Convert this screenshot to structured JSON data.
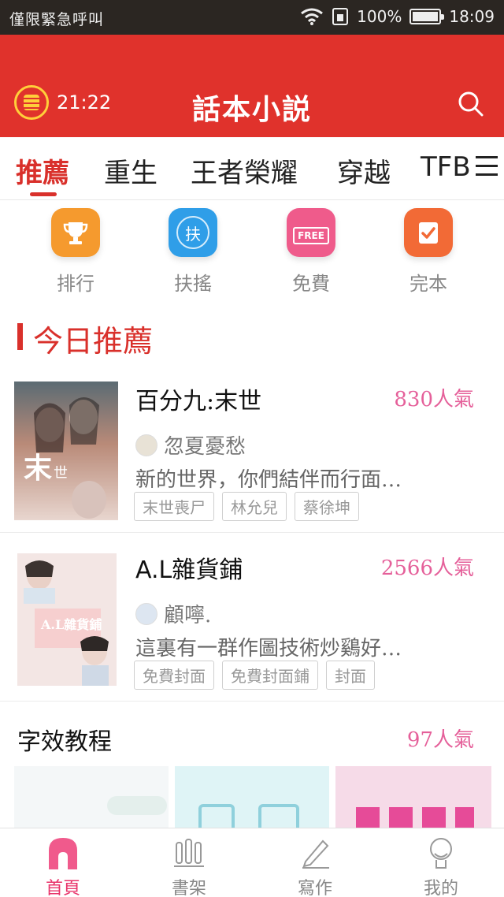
{
  "status_bar": {
    "carrier": "僅限緊急呼叫",
    "battery": "100%",
    "time": "18:09",
    "battery_level": 1.0
  },
  "header": {
    "timer": "21:22",
    "title": "話本小説"
  },
  "tabs": [
    {
      "label": "推薦",
      "active": true
    },
    {
      "label": "重生"
    },
    {
      "label": "王者榮耀"
    },
    {
      "label": "穿越"
    },
    {
      "label": "TFB"
    }
  ],
  "quick_nav": [
    {
      "label": "排行",
      "icon": "trophy-icon",
      "color": "#f59a2e"
    },
    {
      "label": "扶搖",
      "icon": "fuyao-icon",
      "glyph": "扶",
      "color": "#2f9ee8"
    },
    {
      "label": "免費",
      "icon": "free-icon",
      "glyph": "FREE",
      "color": "#ef5b8b"
    },
    {
      "label": "完本",
      "icon": "complete-icon",
      "color": "#f26a36"
    }
  ],
  "section": {
    "title": "今日推薦"
  },
  "books": [
    {
      "name": "百分九:末世",
      "popularity": "830人氣",
      "author": "忽夏憂愁",
      "description": "新的世界，你們結伴而行面…",
      "tags": [
        "末世喪尸",
        "林允兒",
        "蔡徐坤"
      ]
    },
    {
      "name": "A.L雜貨鋪",
      "popularity": "2566人氣",
      "author": "顧嚀.",
      "description": "這裏有一群作圖技術炒鷄好…",
      "tags": [
        "免費封面",
        "免費封面鋪",
        "封面"
      ]
    }
  ],
  "font_tutorial": {
    "title": "字效教程",
    "popularity": "97人氣"
  },
  "bottom_nav": [
    {
      "label": "首頁",
      "icon": "home-icon",
      "active": true
    },
    {
      "label": "書架",
      "icon": "bookshelf-icon"
    },
    {
      "label": "寫作",
      "icon": "pen-icon"
    },
    {
      "label": "我的",
      "icon": "profile-icon"
    }
  ],
  "colors": {
    "brand_red": "#e0322c",
    "accent_pink": "#e5609a",
    "nav_active": "#e8336a"
  }
}
